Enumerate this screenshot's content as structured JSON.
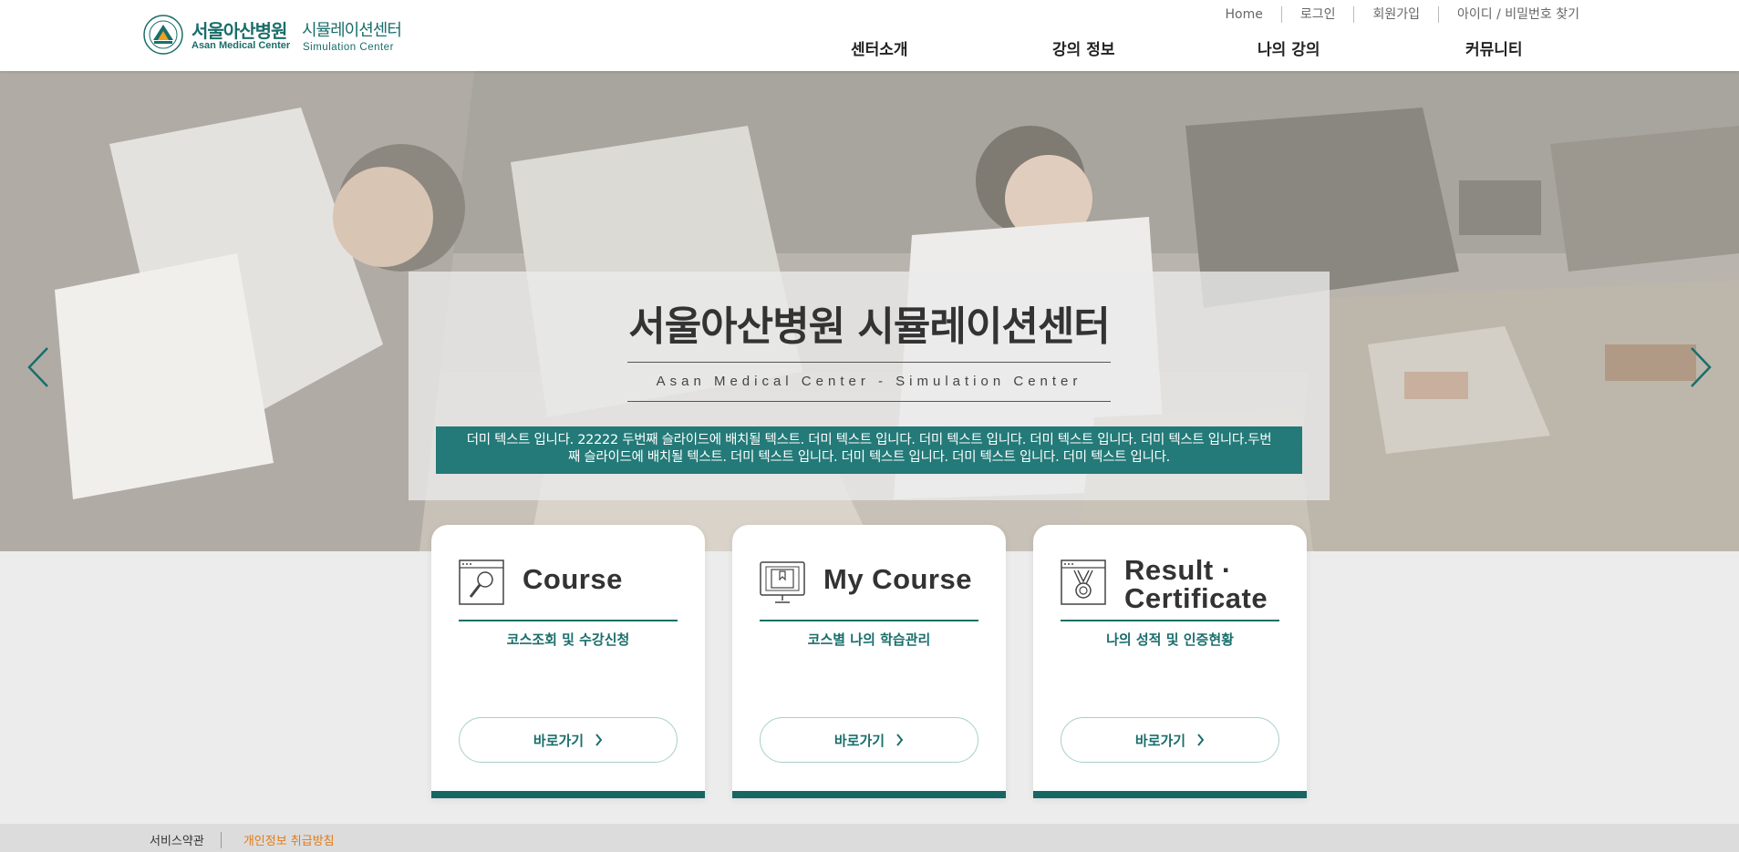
{
  "header": {
    "logo": {
      "name_ko": "서울아산병원",
      "name_en": "Asan Medical Center",
      "center_ko": "시뮬레이션센터",
      "center_en": "Simulation Center"
    },
    "util_links": [
      "Home",
      "로그인",
      "회원가입",
      "아이디 / 비밀번호 찾기"
    ],
    "nav": [
      "센터소개",
      "강의 정보",
      "나의 강의",
      "커뮤니티"
    ]
  },
  "hero": {
    "title": "서울아산병원 시뮬레이션센터",
    "subtitle": "Asan Medical Center - Simulation Center",
    "description": "더미 텍스트 입니다. 22222 두번째 슬라이드에 배치될 텍스트. 더미 텍스트 입니다. 더미 텍스트 입니다. 더미 텍스트 입니다. 더미 텍스트 입니다.두번째 슬라이드에 배치될 텍스트. 더미 텍스트 입니다. 더미 텍스트 입니다. 더미 텍스트 입니다. 더미 텍스트 입니다."
  },
  "cards": [
    {
      "title": "Course",
      "subtitle": "코스조회 및 수강신청",
      "button": "바로가기",
      "icon": "magnifier-icon"
    },
    {
      "title": "My Course",
      "subtitle": "코스별 나의 학습관리",
      "button": "바로가기",
      "icon": "monitor-bookmark-icon"
    },
    {
      "title_line1": "Result ·",
      "title_line2": "Certificate",
      "subtitle": "나의 성적 및 인증현황",
      "button": "바로가기",
      "icon": "medal-icon"
    }
  ],
  "footer": {
    "terms": "서비스약관",
    "privacy": "개인정보 취급방침"
  },
  "colors": {
    "brand": "#1a6e6b",
    "caption_bg": "#237a78",
    "privacy_link": "#e07b1a"
  }
}
